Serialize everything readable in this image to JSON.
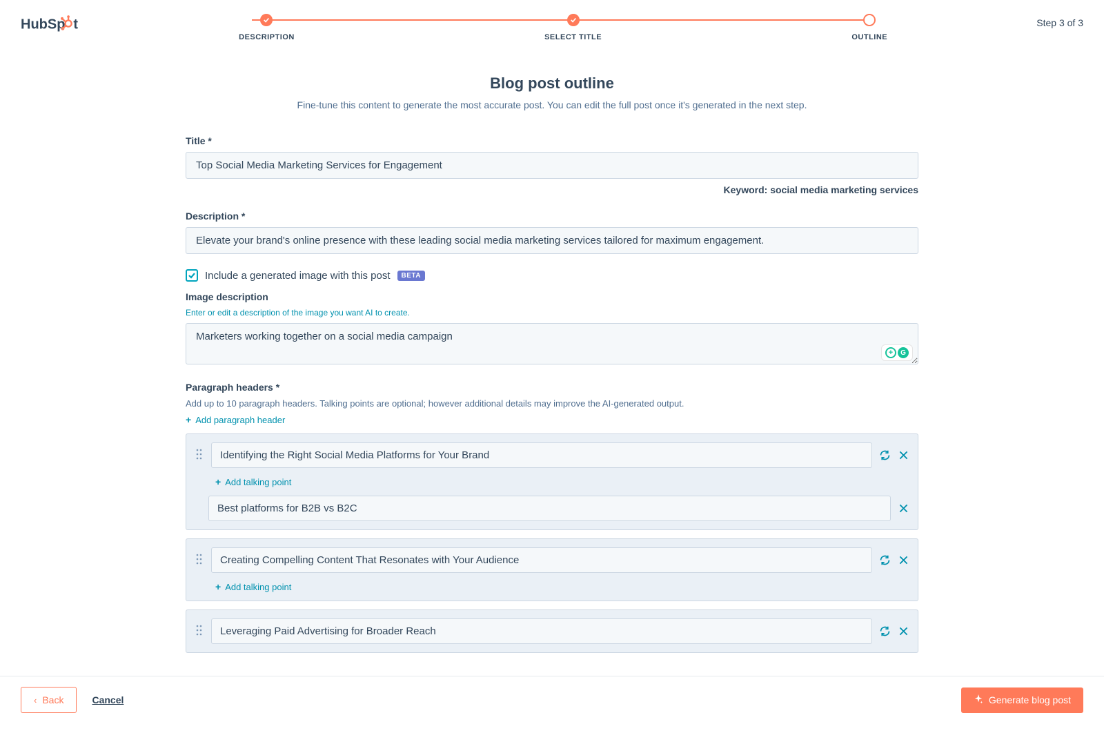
{
  "logo_text": "HubSpot",
  "stepper": {
    "steps": [
      "DESCRIPTION",
      "SELECT TITLE",
      "OUTLINE"
    ],
    "counter": "Step 3 of 3"
  },
  "page": {
    "title": "Blog post outline",
    "subtitle": "Fine-tune this content to generate the most accurate post. You can edit the full post once it's generated in the next step."
  },
  "title_field": {
    "label": "Title *",
    "value": "Top Social Media Marketing Services for Engagement",
    "keyword_prefix": "Keyword: ",
    "keyword": "social media marketing services"
  },
  "description_field": {
    "label": "Description *",
    "value": "Elevate your brand's online presence with these leading social media marketing services tailored for maximum engagement."
  },
  "include_image": {
    "label": "Include a generated image with this post",
    "badge": "BETA",
    "checked": true
  },
  "image_description": {
    "label": "Image description",
    "hint": "Enter or edit a description of the image you want AI to create.",
    "value": "Marketers working together on a social media campaign"
  },
  "paragraph_headers": {
    "label": "Paragraph headers *",
    "hint": "Add up to 10 paragraph headers. Talking points are optional; however additional details may improve the AI-generated output.",
    "add_label": "Add paragraph header",
    "add_talking_label": "Add talking point",
    "items": [
      {
        "title": "Identifying the Right Social Media Platforms for Your Brand",
        "talking_points": [
          "Best platforms for B2B vs B2C"
        ]
      },
      {
        "title": "Creating Compelling Content That Resonates with Your Audience",
        "talking_points": []
      },
      {
        "title": "Leveraging Paid Advertising for Broader Reach",
        "talking_points": []
      }
    ]
  },
  "footer": {
    "back": "Back",
    "cancel": "Cancel",
    "generate": "Generate blog post"
  }
}
